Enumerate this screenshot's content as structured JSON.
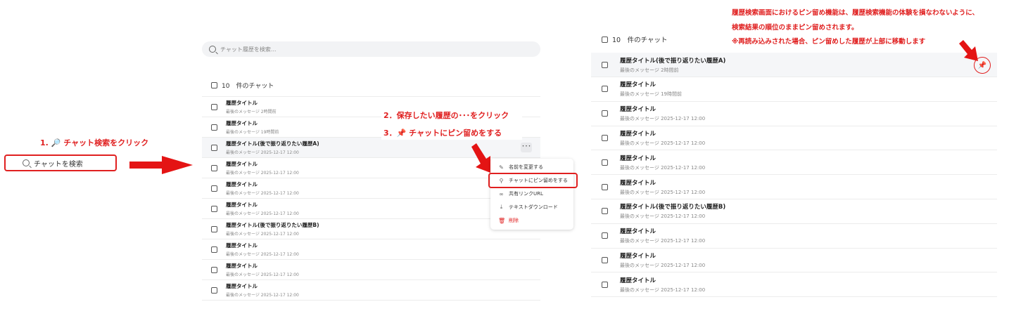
{
  "step1": {
    "label": "1. 🔎 チャット検索をクリック",
    "button_label": "チャットを検索"
  },
  "step2": {
    "label": "2．保存したい履歴の･･･をクリック"
  },
  "step3": {
    "label": "3．📌 チャットにピン留めをする"
  },
  "note": {
    "line1": "履歴検索画面におけるピン留め機能は、履歴検索機能の体験を損なわないように、",
    "line2": "検索結果の順位のままピン留めされます。",
    "line3": "※再読み込みされた場合、ピン留めした履歴が上部に移動します"
  },
  "middle": {
    "search_placeholder": "チャット履歴を検索...",
    "count_label": "10　件のチャット",
    "rows": [
      {
        "title": "履歴タイトル",
        "sub": "最後のメッセージ 2時間前"
      },
      {
        "title": "履歴タイトル",
        "sub": "最後のメッセージ 19時間前"
      },
      {
        "title": "履歴タイトル(後で振り返りたい履歴A)",
        "sub": "最後のメッセージ 2025-12-17 12:00"
      },
      {
        "title": "履歴タイトル",
        "sub": "最後のメッセージ 2025-12-17 12:00"
      },
      {
        "title": "履歴タイトル",
        "sub": "最後のメッセージ 2025-12-17 12:00"
      },
      {
        "title": "履歴タイトル",
        "sub": "最後のメッセージ 2025-12-17 12:00"
      },
      {
        "title": "履歴タイトル(後で振り返りたい履歴B)",
        "sub": "最後のメッセージ 2025-12-17 12:00"
      },
      {
        "title": "履歴タイトル",
        "sub": "最後のメッセージ 2025-12-17 12:00"
      },
      {
        "title": "履歴タイトル",
        "sub": "最後のメッセージ 2025-12-17 12:00"
      },
      {
        "title": "履歴タイトル",
        "sub": "最後のメッセージ 2025-12-17 12:00"
      }
    ],
    "more_button": "･･･",
    "menu": [
      {
        "icon": "✎",
        "icon_name": "pencil-icon",
        "label": "名前を変更する"
      },
      {
        "icon": "⚲",
        "icon_name": "pin-icon",
        "label": "チャットにピン留めをする"
      },
      {
        "icon": "∞",
        "icon_name": "link-icon",
        "label": "共有リンクURL"
      },
      {
        "icon": "⤓",
        "icon_name": "download-icon",
        "label": "テキストダウンロード"
      },
      {
        "icon": "🗑",
        "icon_name": "trash-icon",
        "label": "削除"
      }
    ]
  },
  "right": {
    "count_label": "10　件のチャット",
    "rows": [
      {
        "title": "履歴タイトル(後で振り返りたい履歴A)",
        "sub": "最後のメッセージ 2時間前"
      },
      {
        "title": "履歴タイトル",
        "sub": "最後のメッセージ 19時間前"
      },
      {
        "title": "履歴タイトル",
        "sub": "最後のメッセージ 2025-12-17 12:00"
      },
      {
        "title": "履歴タイトル",
        "sub": "最後のメッセージ 2025-12-17 12:00"
      },
      {
        "title": "履歴タイトル",
        "sub": "最後のメッセージ 2025-12-17 12:00"
      },
      {
        "title": "履歴タイトル",
        "sub": "最後のメッセージ 2025-12-17 12:00"
      },
      {
        "title": "履歴タイトル(後で振り返りたい履歴B)",
        "sub": "最後のメッセージ 2025-12-17 12:00"
      },
      {
        "title": "履歴タイトル",
        "sub": "最後のメッセージ 2025-12-17 12:00"
      },
      {
        "title": "履歴タイトル",
        "sub": "最後のメッセージ 2025-12-17 12:00"
      },
      {
        "title": "履歴タイトル",
        "sub": "最後のメッセージ 2025-12-17 12:00"
      }
    ],
    "pin_icon": "📌"
  },
  "colors": {
    "accent": "#e02020",
    "row_highlight": "#f5f6f8"
  }
}
